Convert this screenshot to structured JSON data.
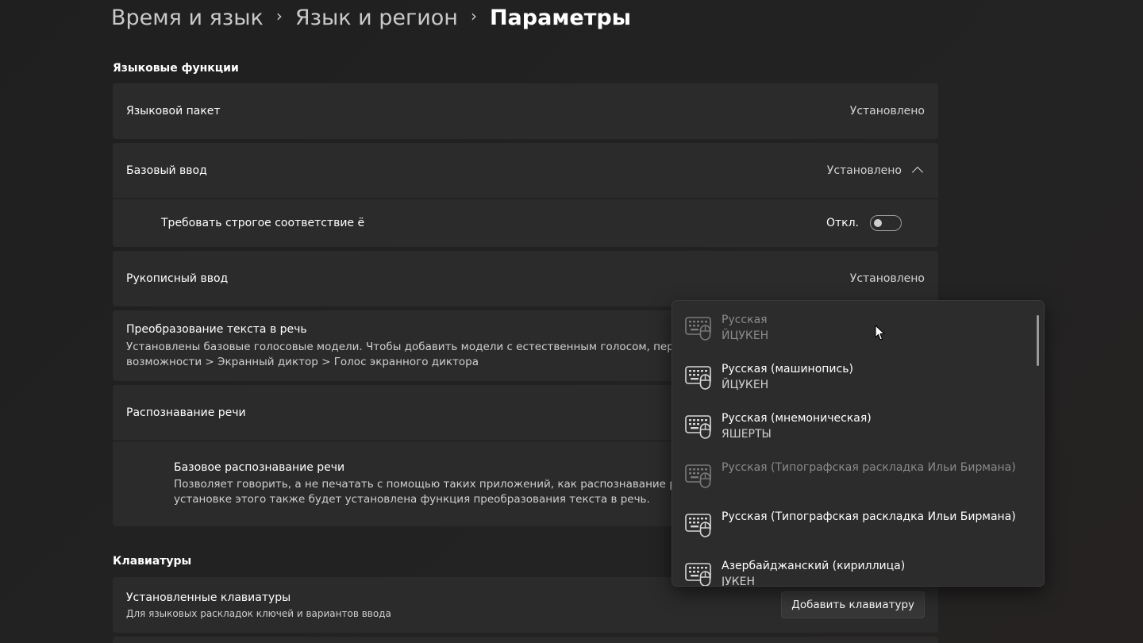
{
  "breadcrumb": {
    "items": [
      "Время и язык",
      "Язык и регион",
      "Параметры"
    ],
    "separator": "›"
  },
  "sections": {
    "language_features": "Языковые функции",
    "keyboards": "Клавиатуры"
  },
  "language_pack": {
    "label": "Языковой пакет",
    "status": "Установлено"
  },
  "basic_typing": {
    "label": "Базовый ввод",
    "status": "Установлено",
    "strict_yo": {
      "label": "Требовать строгое соответствие ё",
      "state": "Откл."
    }
  },
  "handwriting": {
    "label": "Рукописный ввод",
    "status": "Установлено"
  },
  "tts": {
    "label": "Преобразование текста в речь",
    "desc1": "Установлены базовые голосовые модели. Чтобы добавить модели с естественным голосом, перейдите",
    "desc2": "возможности > Экранный диктор > Голос экранного диктора"
  },
  "speech_recognition": {
    "label": "Распознавание речи",
    "basic": {
      "label": "Базовое распознавание речи",
      "desc1": "Позволяет говорить, а не печатать с помощью таких приложений, как распознавание речи W",
      "desc2": "установке этого также будет установлена функция преобразования текста в речь."
    }
  },
  "installed_keyboards": {
    "label": "Установленные клавиатуры",
    "desc": "Для языковых раскладок ключей и вариантов ввода",
    "add_button": "Добавить клавиатуру"
  },
  "keyboard_list": [
    {
      "name": "Русская",
      "layout": "ЙЦУКЕН",
      "enabled": false
    },
    {
      "name": "Русская (машинопись)",
      "layout": "ЙЦУКЕН",
      "enabled": true
    },
    {
      "name": "Русская (мнемоническая)",
      "layout": "ЯШЕРТЫ",
      "enabled": true
    },
    {
      "name": "Русская (Типографская раскладка Ильи Бирмана)",
      "layout": "",
      "enabled": false
    },
    {
      "name": "Русская (Типографская раскладка Ильи Бирмана)",
      "layout": "",
      "enabled": true
    },
    {
      "name": "Азербайджанский (кириллица)",
      "layout": "ЈУКЕН",
      "enabled": true
    }
  ],
  "colors": {
    "background": "#202020",
    "card": "#2b2b2b",
    "flyout": "#2c2c2c"
  },
  "icons": {
    "keyboard": "keyboard-icon",
    "chevron": "chevron-up-icon",
    "cursor": "mouse-cursor-icon"
  }
}
